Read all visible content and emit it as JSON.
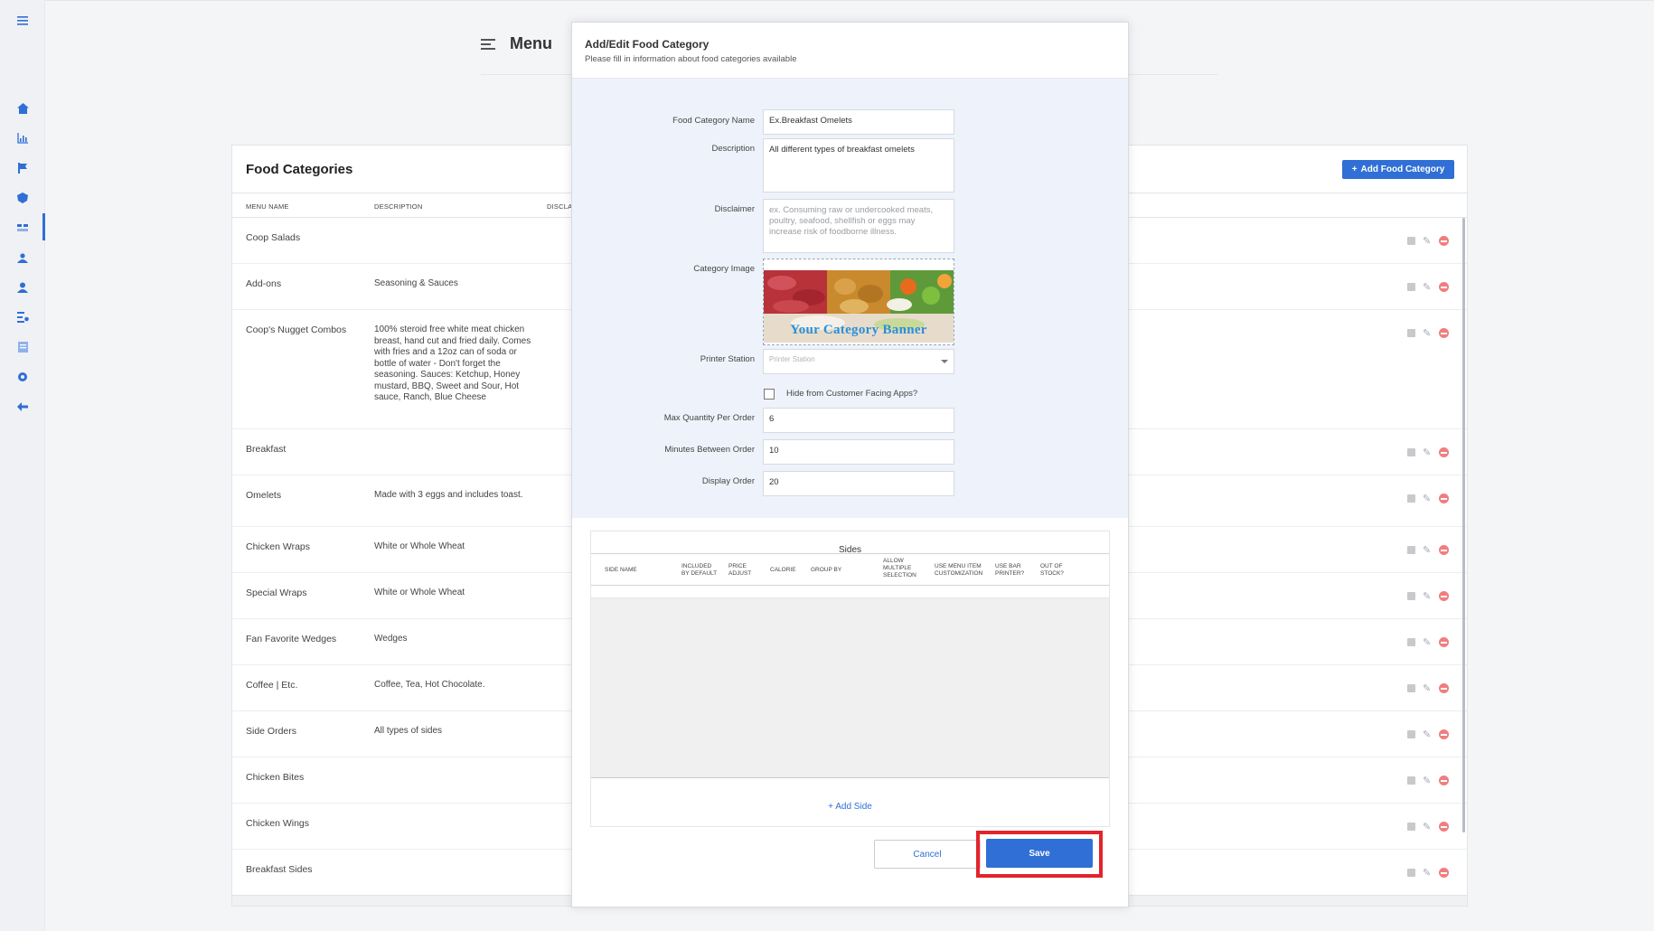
{
  "colors": {
    "accent": "#2f6fd6",
    "danger": "#f07e7e",
    "highlight": "#e3242b"
  },
  "rail": {
    "icons": [
      "menu-icon",
      "home-icon",
      "chart-icon",
      "flag-icon",
      "shield-icon",
      "list-icon",
      "user-group-icon",
      "user-icon",
      "list-settings-icon",
      "document-icon",
      "gear-icon",
      "back-arrow-icon"
    ]
  },
  "page": {
    "title": "Menu"
  },
  "categories": {
    "title": "Food Categories",
    "add_button": "Add Food Category",
    "columns": {
      "name": "MENU NAME",
      "description": "DESCRIPTION",
      "disclaimer": "DISCLA"
    },
    "rows": [
      {
        "name": "Coop Salads",
        "description": ""
      },
      {
        "name": "Add-ons",
        "description": "Seasoning & Sauces"
      },
      {
        "name": "Coop's Nugget Combos",
        "description": "100% steroid free white meat chicken breast, hand cut and fried daily. Comes with fries and a 12oz can of soda or bottle of water - Don't forget the seasoning. Sauces: Ketchup, Honey mustard, BBQ, Sweet and Sour, Hot sauce, Ranch, Blue Cheese"
      },
      {
        "name": "Breakfast",
        "description": ""
      },
      {
        "name": "Omelets",
        "description": "Made with 3 eggs and includes toast."
      },
      {
        "name": "Chicken Wraps",
        "description": "White or Whole Wheat"
      },
      {
        "name": "Special Wraps",
        "description": "White or Whole Wheat"
      },
      {
        "name": "Fan Favorite Wedges",
        "description": "Wedges"
      },
      {
        "name": "Coffee | Etc.",
        "description": "Coffee, Tea, Hot Chocolate."
      },
      {
        "name": "Side Orders",
        "description": "All types of sides"
      },
      {
        "name": "Chicken Bites",
        "description": ""
      },
      {
        "name": "Chicken Wings",
        "description": ""
      },
      {
        "name": "Breakfast Sides",
        "description": ""
      }
    ]
  },
  "modal": {
    "title": "Add/Edit Food Category",
    "subtitle": "Please fill in information about food categories available",
    "labels": {
      "name": "Food Category Name",
      "description": "Description",
      "disclaimer": "Disclaimer",
      "image": "Category Image",
      "printer": "Printer Station",
      "hide": "Hide from Customer Facing Apps?",
      "max_qty": "Max Quantity Per Order",
      "minutes": "Minutes Between Order",
      "display_order": "Display Order"
    },
    "values": {
      "name": "Ex.Breakfast Omelets",
      "description": "All different types of breakfast omelets",
      "max_qty": "6",
      "minutes": "10",
      "display_order": "20"
    },
    "placeholders": {
      "disclaimer": "ex. Consuming raw or undercooked meats, poultry, seafood, shellfish or eggs may increase risk of foodborne illness.",
      "printer": "Printer Station"
    },
    "banner_text": "Your Category Banner",
    "hide_checked": false,
    "sides": {
      "title": "Sides",
      "columns": [
        "SIDE NAME",
        "INCLUDED BY DEFAULT",
        "PRICE ADJUST",
        "CALORIE",
        "GROUP BY",
        "ALLOW MULTIPLE SELECTION",
        "USE MENU ITEM CUSTOMIZATION",
        "USE BAR PRINTER?",
        "OUT OF STOCK?"
      ],
      "add_label": "Add Side"
    },
    "cancel": "Cancel",
    "save": "Save"
  }
}
